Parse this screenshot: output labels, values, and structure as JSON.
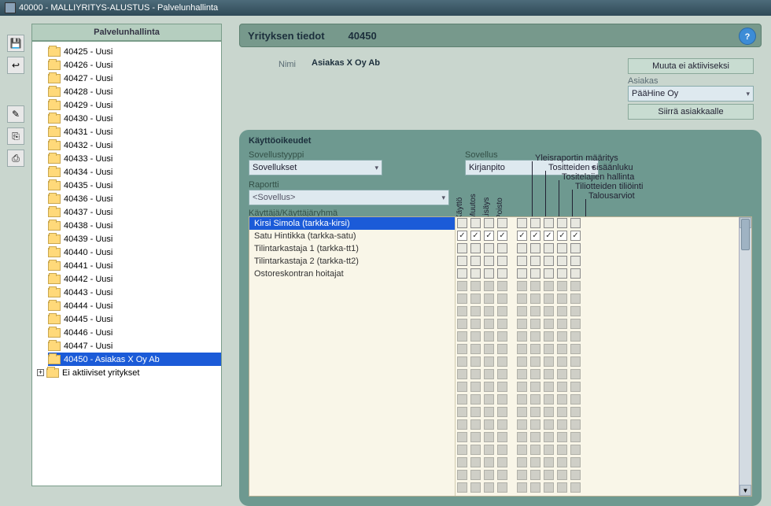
{
  "window": {
    "title": "40000 - MALLIYRITYS-ALUSTUS - Palvelunhallinta"
  },
  "toolbar": {
    "save_icon": "💾",
    "back_icon": "↩",
    "i1": "✎",
    "i2": "⎘",
    "i3": "⎙"
  },
  "tree": {
    "title": "Palvelunhallinta",
    "items": [
      {
        "label": "40425 - Uusi"
      },
      {
        "label": "40426 - Uusi"
      },
      {
        "label": "40427 - Uusi"
      },
      {
        "label": "40428 - Uusi"
      },
      {
        "label": "40429 - Uusi"
      },
      {
        "label": "40430 - Uusi"
      },
      {
        "label": "40431 - Uusi"
      },
      {
        "label": "40432 - Uusi"
      },
      {
        "label": "40433 - Uusi"
      },
      {
        "label": "40434 - Uusi"
      },
      {
        "label": "40435 - Uusi"
      },
      {
        "label": "40436 - Uusi"
      },
      {
        "label": "40437 - Uusi"
      },
      {
        "label": "40438 - Uusi"
      },
      {
        "label": "40439 - Uusi"
      },
      {
        "label": "40440 - Uusi"
      },
      {
        "label": "40441 - Uusi"
      },
      {
        "label": "40442 - Uusi"
      },
      {
        "label": "40443 - Uusi"
      },
      {
        "label": "40444 - Uusi"
      },
      {
        "label": "40445 - Uusi"
      },
      {
        "label": "40446 - Uusi"
      },
      {
        "label": "40447 - Uusi"
      },
      {
        "label": "40450 - Asiakas X Oy Ab",
        "selected": true
      }
    ],
    "inactive_label": "Ei aktiiviset yritykset",
    "expand_symbol": "+"
  },
  "page": {
    "title": "Yrityksen tiedot",
    "id": "40450",
    "help": "?",
    "name_label": "Nimi",
    "name_value": "Asiakas X Oy Ab",
    "deactivate_btn": "Muuta ei aktiiviseksi",
    "customer_label": "Asiakas",
    "customer_value": "PääHine Oy",
    "transfer_btn": "Siirrä asiakkaalle"
  },
  "perm": {
    "title": "Käyttöoikeudet",
    "apptype_label": "Sovellustyyppi",
    "apptype_value": "Sovellukset",
    "app_label": "Sovellus",
    "app_value": "Kirjanpito",
    "report_label": "Raportti",
    "report_value": "<Sovellus>",
    "usergroup_label": "Käyttäjä/Käyttäjäryhmä",
    "cols_basic": [
      "Käyttö",
      "Muutos",
      "Lisäys",
      "Poisto"
    ],
    "cols_ext": [
      "Yleisraportin määritys",
      "Tositteiden sisäänluku",
      "Tositelajien hallinta",
      "Tiliotteiden tiliöinti",
      "Talousarviot"
    ],
    "users": [
      {
        "name": "Kirsi Simola (tarkka-kirsi)",
        "selected": true,
        "basic": [
          false,
          false,
          false,
          false
        ],
        "ext": [
          false,
          false,
          false,
          false,
          false
        ]
      },
      {
        "name": "Satu Hintikka (tarkka-satu)",
        "selected": false,
        "basic": [
          true,
          true,
          true,
          true
        ],
        "ext": [
          true,
          true,
          true,
          true,
          true
        ]
      },
      {
        "name": "Tilintarkastaja 1 (tarkka-tt1)",
        "selected": false,
        "basic": [
          false,
          false,
          false,
          false
        ],
        "ext": [
          false,
          false,
          false,
          false,
          false
        ]
      },
      {
        "name": "Tilintarkastaja 2 (tarkka-tt2)",
        "selected": false,
        "basic": [
          false,
          false,
          false,
          false
        ],
        "ext": [
          false,
          false,
          false,
          false,
          false
        ]
      },
      {
        "name": "Ostoreskontran hoitajat",
        "selected": false,
        "basic": [
          false,
          false,
          false,
          false
        ],
        "ext": [
          false,
          false,
          false,
          false,
          false
        ]
      }
    ],
    "placeholder_rows": 17
  }
}
